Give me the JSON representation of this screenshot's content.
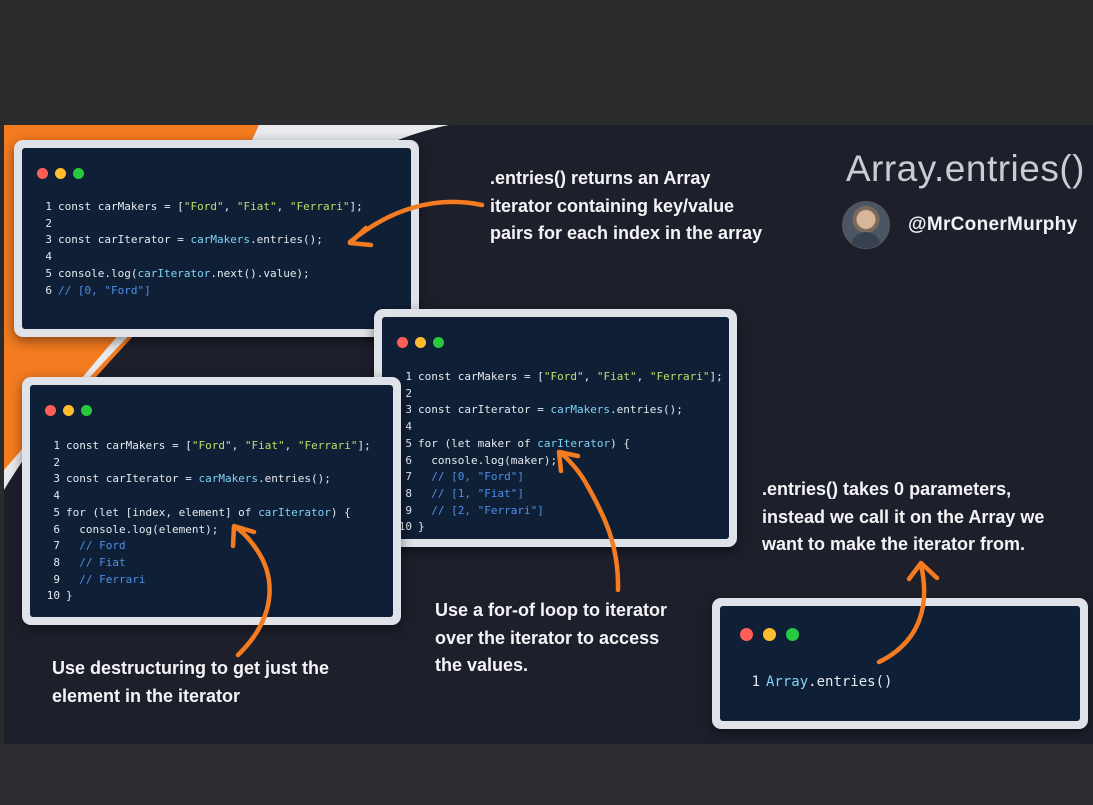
{
  "title": "Array.entries()",
  "author": {
    "handle": "@MrConerMurphy"
  },
  "colors": {
    "orange": "#f47b20",
    "slide_bg": "#1d1f2b",
    "code_bg": "#0f1f36",
    "string": "#b8e06a",
    "comment": "#4d8fe8"
  },
  "notes": {
    "returns": ".entries() returns an Array iterator containing key/value pairs for each index in the array",
    "returns_lines": [
      ".entries() returns an Array",
      "iterator containing key/value",
      "pairs for each index in the array"
    ],
    "params_lines": [
      ".entries() takes 0 parameters,",
      "instead we call it on the Array we",
      "want to make the iterator from."
    ],
    "forof_lines": [
      "Use a for-of loop to iterator",
      "over the iterator to access",
      "the values."
    ],
    "destructure_lines": [
      "Use destructuring to get just the",
      "element in the iterator"
    ]
  },
  "cards": {
    "card1": [
      {
        "n": "1",
        "parts": [
          [
            "",
            "const carMakers = ["
          ],
          [
            "s",
            "\"Ford\""
          ],
          [
            "",
            ", "
          ],
          [
            "s",
            "\"Fiat\""
          ],
          [
            "",
            ", "
          ],
          [
            "s",
            "\"Ferrari\""
          ],
          [
            "",
            "];"
          ]
        ]
      },
      {
        "n": "2",
        "parts": []
      },
      {
        "n": "3",
        "parts": [
          [
            "",
            "const carIterator = "
          ],
          [
            "v",
            "carMakers"
          ],
          [
            "",
            ".entries();"
          ]
        ]
      },
      {
        "n": "4",
        "parts": []
      },
      {
        "n": "5",
        "parts": [
          [
            "",
            "console.log("
          ],
          [
            "v",
            "carIterator"
          ],
          [
            "",
            ".next().value);"
          ]
        ]
      },
      {
        "n": "6",
        "parts": [
          [
            "c",
            "// [0, \"Ford\"]"
          ]
        ]
      }
    ],
    "card2": [
      {
        "n": "1",
        "parts": [
          [
            "",
            "const carMakers = ["
          ],
          [
            "s",
            "\"Ford\""
          ],
          [
            "",
            ", "
          ],
          [
            "s",
            "\"Fiat\""
          ],
          [
            "",
            ", "
          ],
          [
            "s",
            "\"Ferrari\""
          ],
          [
            "",
            "];"
          ]
        ]
      },
      {
        "n": "2",
        "parts": []
      },
      {
        "n": "3",
        "parts": [
          [
            "",
            "const carIterator = "
          ],
          [
            "v",
            "carMakers"
          ],
          [
            "",
            ".entries();"
          ]
        ]
      },
      {
        "n": "4",
        "parts": []
      },
      {
        "n": "5",
        "parts": [
          [
            "",
            "for (let maker of "
          ],
          [
            "v",
            "carIterator"
          ],
          [
            "",
            ") {"
          ]
        ]
      },
      {
        "n": "6",
        "parts": [
          [
            "",
            "  console.log(maker);"
          ]
        ]
      },
      {
        "n": "7",
        "parts": [
          [
            "c",
            "  // [0, \"Ford\"]"
          ]
        ]
      },
      {
        "n": "8",
        "parts": [
          [
            "c",
            "  // [1, \"Fiat\"]"
          ]
        ]
      },
      {
        "n": "9",
        "parts": [
          [
            "c",
            "  // [2, \"Ferrari\"]"
          ]
        ]
      },
      {
        "n": "10",
        "parts": [
          [
            "",
            "}"
          ]
        ]
      }
    ],
    "card3": [
      {
        "n": "1",
        "parts": [
          [
            "",
            "const carMakers = ["
          ],
          [
            "s",
            "\"Ford\""
          ],
          [
            "",
            ", "
          ],
          [
            "s",
            "\"Fiat\""
          ],
          [
            "",
            ", "
          ],
          [
            "s",
            "\"Ferrari\""
          ],
          [
            "",
            "];"
          ]
        ]
      },
      {
        "n": "2",
        "parts": []
      },
      {
        "n": "3",
        "parts": [
          [
            "",
            "const carIterator = "
          ],
          [
            "v",
            "carMakers"
          ],
          [
            "",
            ".entries();"
          ]
        ]
      },
      {
        "n": "4",
        "parts": []
      },
      {
        "n": "5",
        "parts": [
          [
            "",
            "for (let [index, element] of "
          ],
          [
            "v",
            "carIterator"
          ],
          [
            "",
            ") {"
          ]
        ]
      },
      {
        "n": "6",
        "parts": [
          [
            "",
            "  console.log(element);"
          ]
        ]
      },
      {
        "n": "7",
        "parts": [
          [
            "c",
            "  // Ford"
          ]
        ]
      },
      {
        "n": "8",
        "parts": [
          [
            "c",
            "  // Fiat"
          ]
        ]
      },
      {
        "n": "9",
        "parts": [
          [
            "c",
            "  // Ferrari"
          ]
        ]
      },
      {
        "n": "10",
        "parts": [
          [
            "",
            "}"
          ]
        ]
      }
    ],
    "card4": [
      {
        "n": "1",
        "parts": [
          [
            "v",
            "Array"
          ],
          [
            "",
            ".entries()"
          ]
        ]
      }
    ]
  }
}
